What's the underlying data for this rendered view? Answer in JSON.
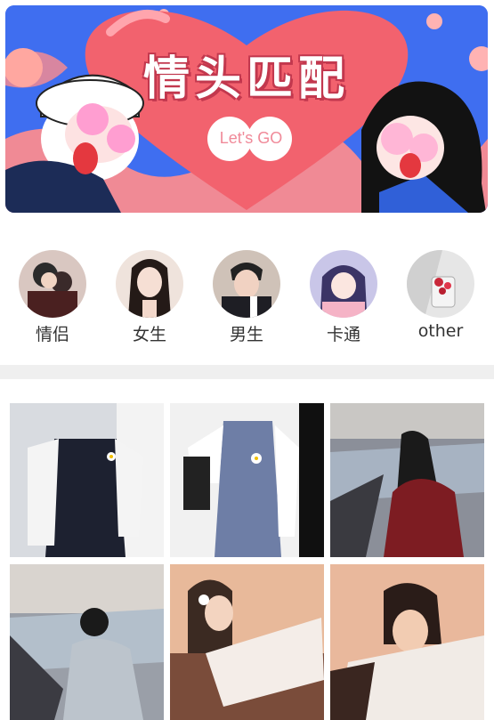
{
  "banner": {
    "title": "情头匹配",
    "button_label": "Let's GO"
  },
  "categories": [
    {
      "label": "情侣",
      "icon": "couple-avatar"
    },
    {
      "label": "女生",
      "icon": "girl-avatar"
    },
    {
      "label": "男生",
      "icon": "boy-avatar"
    },
    {
      "label": "卡通",
      "icon": "cartoon-avatar"
    },
    {
      "label": "other",
      "icon": "other-avatar"
    }
  ],
  "colors": {
    "banner_blue": "#3f6ef0",
    "heart_red": "#f2626e",
    "text": "#333333",
    "divider": "#efefef"
  }
}
